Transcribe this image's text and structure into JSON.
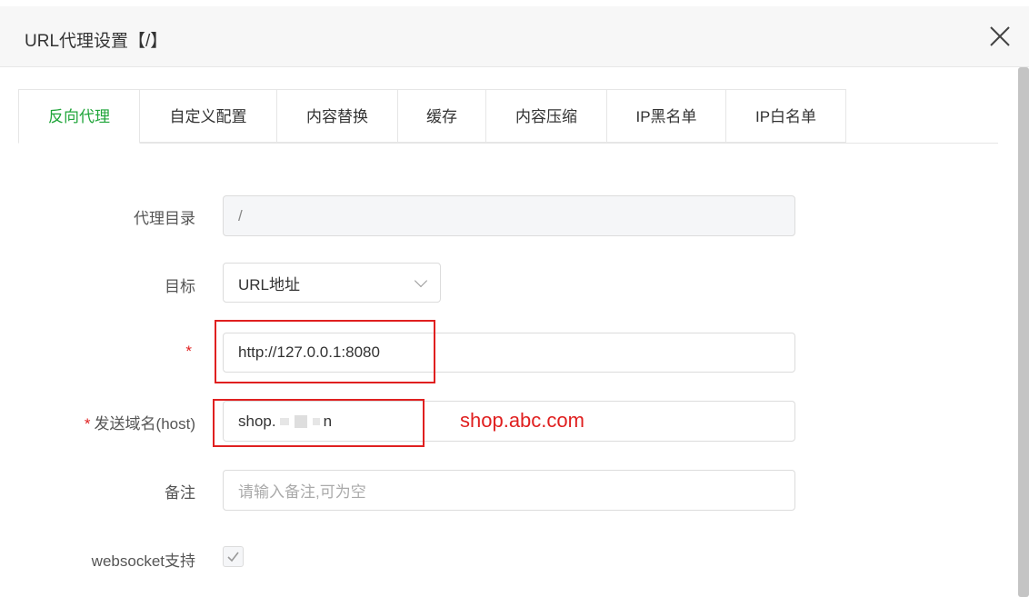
{
  "dialog": {
    "title": "URL代理设置【/】"
  },
  "tabs": [
    {
      "label": "反向代理",
      "active": true
    },
    {
      "label": "自定义配置"
    },
    {
      "label": "内容替换"
    },
    {
      "label": "缓存"
    },
    {
      "label": "内容压缩"
    },
    {
      "label": "IP黑名单"
    },
    {
      "label": "IP白名单"
    }
  ],
  "form": {
    "proxy_dir": {
      "label": "代理目录",
      "value": "/"
    },
    "target": {
      "label": "目标",
      "value": "URL地址"
    },
    "target_url": {
      "required_mark": "*",
      "value": "http://127.0.0.1:8080"
    },
    "host": {
      "required_mark": "*",
      "label": "发送域名(host)",
      "value_prefix": "shop.",
      "value_suffix": "n"
    },
    "remark": {
      "label": "备注",
      "placeholder": "请输入备注,可为空"
    },
    "websocket": {
      "label": "websocket支持",
      "checked": true
    }
  },
  "annotation": {
    "text": "shop.abc.com",
    "color": "#e02020"
  },
  "colors": {
    "accent": "#20a53a",
    "highlight": "#e02020"
  }
}
